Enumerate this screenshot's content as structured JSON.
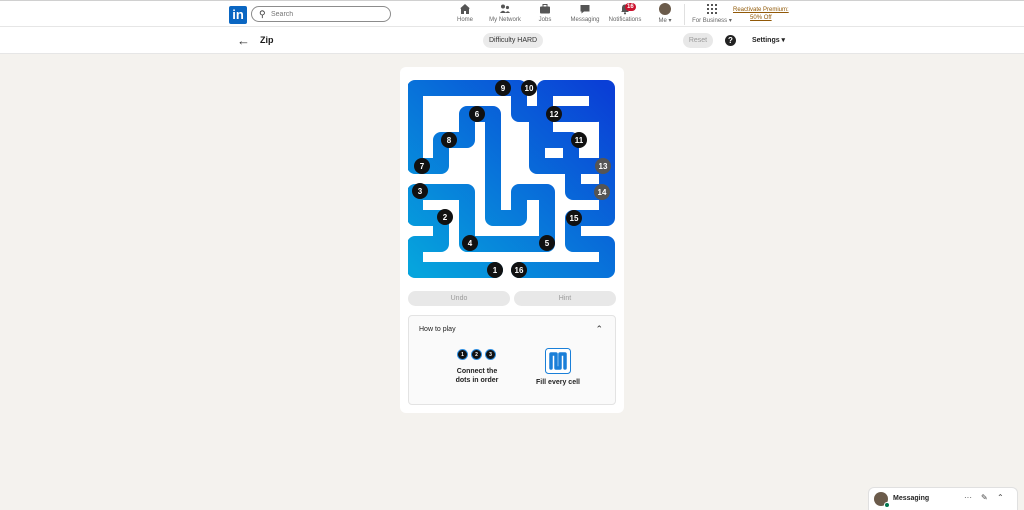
{
  "nav": {
    "logo_text": "in",
    "search_placeholder": "Search",
    "items": [
      {
        "label": "Home",
        "icon": "home-icon"
      },
      {
        "label": "My Network",
        "icon": "network-icon"
      },
      {
        "label": "Jobs",
        "icon": "briefcase-icon"
      },
      {
        "label": "Messaging",
        "icon": "chat-icon"
      },
      {
        "label": "Notifications",
        "icon": "bell-icon",
        "badge": "16"
      },
      {
        "label": "Me ▾",
        "icon": "avatar"
      },
      {
        "label": "For Business ▾",
        "icon": "grid-icon"
      }
    ],
    "premium_line1": "Reactivate Premium:",
    "premium_line2": "50% Off"
  },
  "game": {
    "back_glyph": "←",
    "title": "Zip",
    "difficulty": "Difficulty HARD",
    "reset": "Reset",
    "help_glyph": "?",
    "settings": "Settings ▾"
  },
  "board": {
    "path_colors": {
      "start": "#06a4dd",
      "end": "#0a3fd6"
    },
    "dots": [
      "1",
      "2",
      "3",
      "4",
      "5",
      "6",
      "7",
      "8",
      "9",
      "10",
      "11",
      "12",
      "13",
      "14",
      "15",
      "16"
    ]
  },
  "controls": {
    "undo": "Undo",
    "hint": "Hint"
  },
  "howto": {
    "heading": "How to play",
    "collapse_glyph": "⌃",
    "step1_dots": [
      "1",
      "2",
      "3"
    ],
    "step1_line1": "Connect the",
    "step1_line2": "dots in order",
    "step2_text": "Fill every cell"
  },
  "messaging": {
    "label": "Messaging",
    "more": "···",
    "compose": "✎",
    "expand": "⌃"
  }
}
